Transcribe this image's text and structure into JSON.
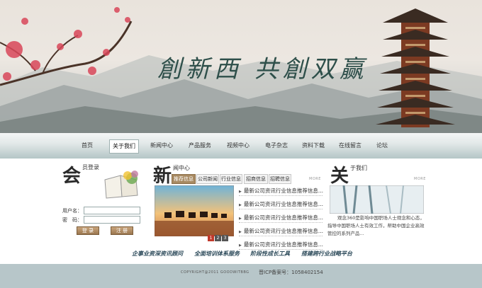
{
  "banner": {
    "slogan": "創新西  共創双赢"
  },
  "nav": {
    "items": [
      "首页",
      "关于我们",
      "新闻中心",
      "产品服务",
      "视频中心",
      "电子杂志",
      "资料下载",
      "在线留言",
      "论坛"
    ],
    "active_index": 1
  },
  "login": {
    "title_char": "会",
    "title_rest": "员登录",
    "username_label": "用户名：",
    "password_label": "密　码：",
    "login_button": "登 录",
    "register_button": "注 册"
  },
  "news": {
    "title_char": "新",
    "title_rest": "闻中心",
    "more": "MORE",
    "tabs": [
      "推荐信息",
      "公司新闻",
      "行业信息",
      "招商信息",
      "招聘信息"
    ],
    "active_tab": 0,
    "items": [
      "最新公司资讯行业信息推荐信息...",
      "最新公司资讯行业信息推荐信息...",
      "最新公司资讯行业信息推荐信息...",
      "最新公司资讯行业信息推荐信息...",
      "最新公司资讯行业信息推荐信息..."
    ],
    "pager": [
      "1",
      "2",
      "3"
    ],
    "pager_active": 0
  },
  "about": {
    "title_char": "关",
    "title_rest": "于我们",
    "more": "MORE",
    "text": "观念360是影响中国职场人士观念和心态，指导中国职场人士有效工作，帮助中国企业高效管控的系列产品..."
  },
  "links": [
    "企事业资深资讯顾问",
    "全面培训体系服务",
    "阶段性成长工具",
    "搭建跨行业战略平台"
  ],
  "footer": {
    "copyright": "COPYRIGHT@2011 GOODWITBBG",
    "icp": "晋ICP备案号：1058402154"
  },
  "colors": {
    "nav_bar": "#b4c5c6",
    "footer": "#b7c6c9",
    "accent_brown": "#a88a62",
    "link_blue": "#2c4a5a"
  }
}
